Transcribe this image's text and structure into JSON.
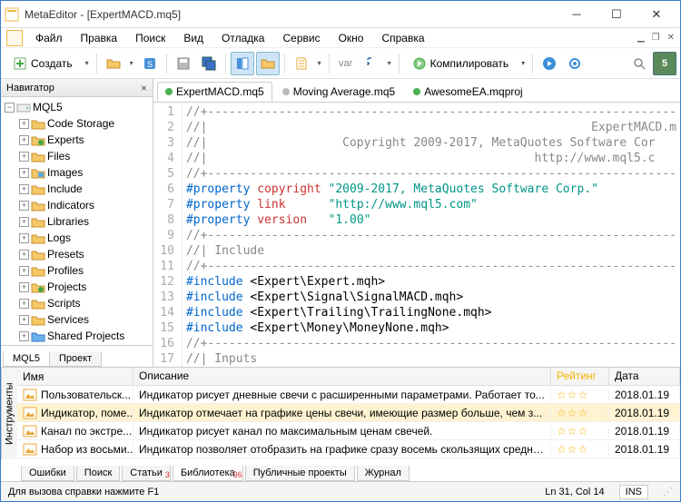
{
  "titlebar": {
    "title": "MetaEditor - [ExpertMACD.mq5]"
  },
  "menubar": [
    "Файл",
    "Правка",
    "Поиск",
    "Вид",
    "Отладка",
    "Сервис",
    "Окно",
    "Справка"
  ],
  "toolbar": {
    "create_label": "Создать",
    "compile_label": "Компилировать",
    "count_badge": "5"
  },
  "navigator": {
    "title": "Навигатор",
    "root": "MQL5",
    "items": [
      {
        "label": "Code Storage",
        "type": "folder"
      },
      {
        "label": "Experts",
        "type": "check"
      },
      {
        "label": "Files",
        "type": "folder"
      },
      {
        "label": "Images",
        "type": "image"
      },
      {
        "label": "Include",
        "type": "folder"
      },
      {
        "label": "Indicators",
        "type": "folder"
      },
      {
        "label": "Libraries",
        "type": "folder"
      },
      {
        "label": "Logs",
        "type": "folder"
      },
      {
        "label": "Presets",
        "type": "folder"
      },
      {
        "label": "Profiles",
        "type": "folder"
      },
      {
        "label": "Projects",
        "type": "check"
      },
      {
        "label": "Scripts",
        "type": "folder"
      },
      {
        "label": "Services",
        "type": "folder"
      },
      {
        "label": "Shared Projects",
        "type": "blue"
      }
    ],
    "tabs": [
      "MQL5",
      "Проект"
    ]
  },
  "editor": {
    "tabs": [
      {
        "label": "ExpertMACD.mq5",
        "color": "#4caf50",
        "active": true
      },
      {
        "label": "Moving Average.mq5",
        "color": "#bbb",
        "active": false
      },
      {
        "label": "AwesomeEA.mqproj",
        "color": "#4caf50",
        "active": false
      }
    ],
    "lines": [
      {
        "n": 1,
        "cls": "c-cmt",
        "text": "//+------------------------------------------------------------------"
      },
      {
        "n": 2,
        "cls": "c-cmt",
        "text": "//|                                                      ExpertMACD.m"
      },
      {
        "n": 3,
        "cls": "c-cmt",
        "text": "//|                   Copyright 2009-2017, MetaQuotes Software Cor"
      },
      {
        "n": 4,
        "cls": "c-cmt",
        "text": "//|                                              http://www.mql5.c"
      },
      {
        "n": 5,
        "cls": "c-cmt",
        "text": "//+------------------------------------------------------------------"
      },
      {
        "n": 6,
        "segs": [
          {
            "cls": "c-pp",
            "t": "#property "
          },
          {
            "cls": "c-kw",
            "t": "copyright "
          },
          {
            "cls": "c-str",
            "t": "\"2009-2017, MetaQuotes Software Corp.\""
          }
        ]
      },
      {
        "n": 7,
        "segs": [
          {
            "cls": "c-pp",
            "t": "#property "
          },
          {
            "cls": "c-kw",
            "t": "link      "
          },
          {
            "cls": "c-str",
            "t": "\"http://www.mql5.com\""
          }
        ]
      },
      {
        "n": 8,
        "segs": [
          {
            "cls": "c-pp",
            "t": "#property "
          },
          {
            "cls": "c-kw",
            "t": "version   "
          },
          {
            "cls": "c-str",
            "t": "\"1.00\""
          }
        ]
      },
      {
        "n": 9,
        "cls": "c-cmt",
        "text": "//+------------------------------------------------------------------"
      },
      {
        "n": 10,
        "cls": "c-cmt",
        "text": "//| Include                                                          "
      },
      {
        "n": 11,
        "cls": "c-cmt",
        "text": "//+------------------------------------------------------------------"
      },
      {
        "n": 12,
        "segs": [
          {
            "cls": "c-pp",
            "t": "#include "
          },
          {
            "cls": "",
            "t": "<Expert\\Expert.mqh>"
          }
        ]
      },
      {
        "n": 13,
        "segs": [
          {
            "cls": "c-pp",
            "t": "#include "
          },
          {
            "cls": "",
            "t": "<Expert\\Signal\\SignalMACD.mqh>"
          }
        ]
      },
      {
        "n": 14,
        "segs": [
          {
            "cls": "c-pp",
            "t": "#include "
          },
          {
            "cls": "",
            "t": "<Expert\\Trailing\\TrailingNone.mqh>"
          }
        ]
      },
      {
        "n": 15,
        "segs": [
          {
            "cls": "c-pp",
            "t": "#include "
          },
          {
            "cls": "",
            "t": "<Expert\\Money\\MoneyNone.mqh>"
          }
        ]
      },
      {
        "n": 16,
        "cls": "c-cmt",
        "text": "//+------------------------------------------------------------------"
      },
      {
        "n": 17,
        "cls": "c-cmt",
        "text": "//| Inputs                                                           "
      }
    ]
  },
  "bottom": {
    "vtab": "Инструменты",
    "headers": {
      "name": "Имя",
      "desc": "Описание",
      "rate": "Рейтинг",
      "date": "Дата"
    },
    "rows": [
      {
        "name": "Пользовательск...",
        "desc": "Индикатор рисует дневные свечи с расширенными параметрами. Работает то...",
        "date": "2018.01.19",
        "sel": false
      },
      {
        "name": "Индикатор, поме...",
        "desc": "Индикатор отмечает на графике цены свечи, имеющие размер больше, чем з...",
        "date": "2018.01.19",
        "sel": true
      },
      {
        "name": "Канал по экстре...",
        "desc": "Индикатор рисует канал по максимальным ценам свечей.",
        "date": "2018.01.19",
        "sel": false
      },
      {
        "name": "Набор из восьми...",
        "desc": "Индикатор позволяет отобразить на графике сразу восемь скользящих средни...",
        "date": "2018.01.19",
        "sel": false
      }
    ],
    "tabs": [
      {
        "label": "Ошибки"
      },
      {
        "label": "Поиск"
      },
      {
        "label": "Статьи",
        "badge": "3"
      },
      {
        "label": "Библиотека",
        "badge": "36",
        "active": true
      },
      {
        "label": "Публичные проекты"
      },
      {
        "label": "Журнал"
      }
    ]
  },
  "status": {
    "help": "Для вызова справки нажмите F1",
    "pos": "Ln 31, Col 14",
    "ins": "INS"
  }
}
